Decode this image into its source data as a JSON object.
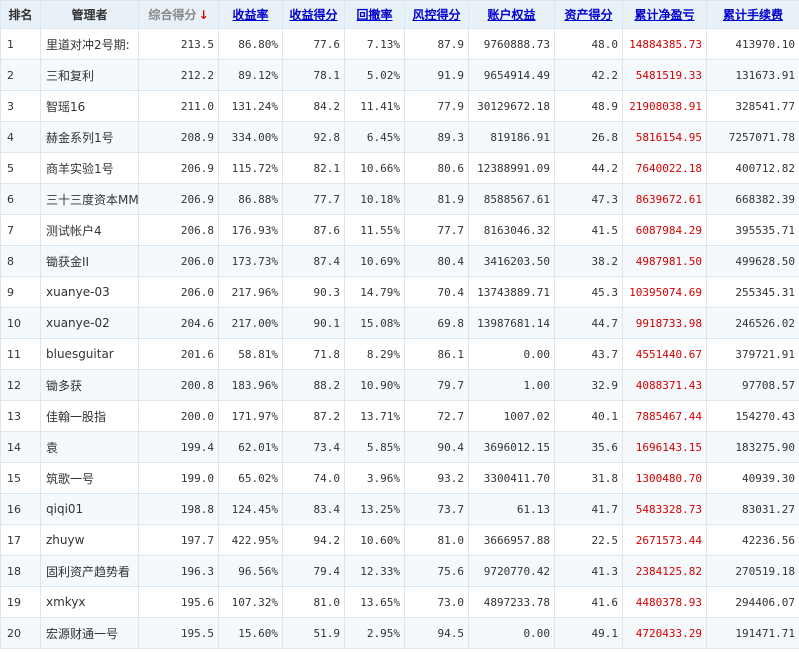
{
  "headers": {
    "rank": "排名",
    "manager": "管理者",
    "score": "综合得分",
    "sort_arrow": "↓",
    "return_rate": "收益率",
    "return_score": "收益得分",
    "drawdown": "回撤率",
    "risk_score": "风控得分",
    "equity": "账户权益",
    "asset_score": "资产得分",
    "net_profit": "累计净盈亏",
    "fees": "累计手续费"
  },
  "colors": {
    "header_bg": "#e9f1f8",
    "link": "#0000cc",
    "profit": "#d40000",
    "sort_arrow": "#d00000"
  },
  "rows": [
    {
      "rank": "1",
      "name": "里道对冲2号期:",
      "score": "213.5",
      "return_rate": "86.80%",
      "return_score": "77.6",
      "drawdown": "7.13%",
      "risk_score": "87.9",
      "equity": "9760888.73",
      "asset_score": "48.0",
      "net_profit": "14884385.73",
      "fees": "413970.10"
    },
    {
      "rank": "2",
      "name": "三和复利",
      "score": "212.2",
      "return_rate": "89.12%",
      "return_score": "78.1",
      "drawdown": "5.02%",
      "risk_score": "91.9",
      "equity": "9654914.49",
      "asset_score": "42.2",
      "net_profit": "5481519.33",
      "fees": "131673.91"
    },
    {
      "rank": "3",
      "name": "智瑶16",
      "score": "211.0",
      "return_rate": "131.24%",
      "return_score": "84.2",
      "drawdown": "11.41%",
      "risk_score": "77.9",
      "equity": "30129672.18",
      "asset_score": "48.9",
      "net_profit": "21908038.91",
      "fees": "328541.77"
    },
    {
      "rank": "4",
      "name": "赫金系列1号",
      "score": "208.9",
      "return_rate": "334.00%",
      "return_score": "92.8",
      "drawdown": "6.45%",
      "risk_score": "89.3",
      "equity": "819186.91",
      "asset_score": "26.8",
      "net_profit": "5816154.95",
      "fees": "7257071.78"
    },
    {
      "rank": "5",
      "name": "商羊实验1号",
      "score": "206.9",
      "return_rate": "115.72%",
      "return_score": "82.1",
      "drawdown": "10.66%",
      "risk_score": "80.6",
      "equity": "12388991.09",
      "asset_score": "44.2",
      "net_profit": "7640022.18",
      "fees": "400712.82"
    },
    {
      "rank": "6",
      "name": "三十三度资本MM",
      "score": "206.9",
      "return_rate": "86.88%",
      "return_score": "77.7",
      "drawdown": "10.18%",
      "risk_score": "81.9",
      "equity": "8588567.61",
      "asset_score": "47.3",
      "net_profit": "8639672.61",
      "fees": "668382.39"
    },
    {
      "rank": "7",
      "name": "测试帐户4",
      "score": "206.8",
      "return_rate": "176.93%",
      "return_score": "87.6",
      "drawdown": "11.55%",
      "risk_score": "77.7",
      "equity": "8163046.32",
      "asset_score": "41.5",
      "net_profit": "6087984.29",
      "fees": "395535.71"
    },
    {
      "rank": "8",
      "name": "锄获金II",
      "score": "206.0",
      "return_rate": "173.73%",
      "return_score": "87.4",
      "drawdown": "10.69%",
      "risk_score": "80.4",
      "equity": "3416203.50",
      "asset_score": "38.2",
      "net_profit": "4987981.50",
      "fees": "499628.50"
    },
    {
      "rank": "9",
      "name": "xuanye-03",
      "score": "206.0",
      "return_rate": "217.96%",
      "return_score": "90.3",
      "drawdown": "14.79%",
      "risk_score": "70.4",
      "equity": "13743889.71",
      "asset_score": "45.3",
      "net_profit": "10395074.69",
      "fees": "255345.31"
    },
    {
      "rank": "10",
      "name": "xuanye-02",
      "score": "204.6",
      "return_rate": "217.00%",
      "return_score": "90.1",
      "drawdown": "15.08%",
      "risk_score": "69.8",
      "equity": "13987681.14",
      "asset_score": "44.7",
      "net_profit": "9918733.98",
      "fees": "246526.02"
    },
    {
      "rank": "11",
      "name": "bluesguitar",
      "score": "201.6",
      "return_rate": "58.81%",
      "return_score": "71.8",
      "drawdown": "8.29%",
      "risk_score": "86.1",
      "equity": "0.00",
      "asset_score": "43.7",
      "net_profit": "4551440.67",
      "fees": "379721.91"
    },
    {
      "rank": "12",
      "name": "锄多获",
      "score": "200.8",
      "return_rate": "183.96%",
      "return_score": "88.2",
      "drawdown": "10.90%",
      "risk_score": "79.7",
      "equity": "1.00",
      "asset_score": "32.9",
      "net_profit": "4088371.43",
      "fees": "97708.57"
    },
    {
      "rank": "13",
      "name": "佳翰一股指",
      "score": "200.0",
      "return_rate": "171.97%",
      "return_score": "87.2",
      "drawdown": "13.71%",
      "risk_score": "72.7",
      "equity": "1007.02",
      "asset_score": "40.1",
      "net_profit": "7885467.44",
      "fees": "154270.43"
    },
    {
      "rank": "14",
      "name": "袁",
      "score": "199.4",
      "return_rate": "62.01%",
      "return_score": "73.4",
      "drawdown": "5.85%",
      "risk_score": "90.4",
      "equity": "3696012.15",
      "asset_score": "35.6",
      "net_profit": "1696143.15",
      "fees": "183275.90"
    },
    {
      "rank": "15",
      "name": "筑歌一号",
      "score": "199.0",
      "return_rate": "65.02%",
      "return_score": "74.0",
      "drawdown": "3.96%",
      "risk_score": "93.2",
      "equity": "3300411.70",
      "asset_score": "31.8",
      "net_profit": "1300480.70",
      "fees": "40939.30"
    },
    {
      "rank": "16",
      "name": "qiqi01",
      "score": "198.8",
      "return_rate": "124.45%",
      "return_score": "83.4",
      "drawdown": "13.25%",
      "risk_score": "73.7",
      "equity": "61.13",
      "asset_score": "41.7",
      "net_profit": "5483328.73",
      "fees": "83031.27"
    },
    {
      "rank": "17",
      "name": "zhuyw",
      "score": "197.7",
      "return_rate": "422.95%",
      "return_score": "94.2",
      "drawdown": "10.60%",
      "risk_score": "81.0",
      "equity": "3666957.88",
      "asset_score": "22.5",
      "net_profit": "2671573.44",
      "fees": "42236.56"
    },
    {
      "rank": "18",
      "name": "固利资产趋势看",
      "score": "196.3",
      "return_rate": "96.56%",
      "return_score": "79.4",
      "drawdown": "12.33%",
      "risk_score": "75.6",
      "equity": "9720770.42",
      "asset_score": "41.3",
      "net_profit": "2384125.82",
      "fees": "270519.18"
    },
    {
      "rank": "19",
      "name": "xmkyx",
      "score": "195.6",
      "return_rate": "107.32%",
      "return_score": "81.0",
      "drawdown": "13.65%",
      "risk_score": "73.0",
      "equity": "4897233.78",
      "asset_score": "41.6",
      "net_profit": "4480378.93",
      "fees": "294406.07"
    },
    {
      "rank": "20",
      "name": "宏源财通一号",
      "score": "195.5",
      "return_rate": "15.60%",
      "return_score": "51.9",
      "drawdown": "2.95%",
      "risk_score": "94.5",
      "equity": "0.00",
      "asset_score": "49.1",
      "net_profit": "4720433.29",
      "fees": "191471.71"
    }
  ]
}
